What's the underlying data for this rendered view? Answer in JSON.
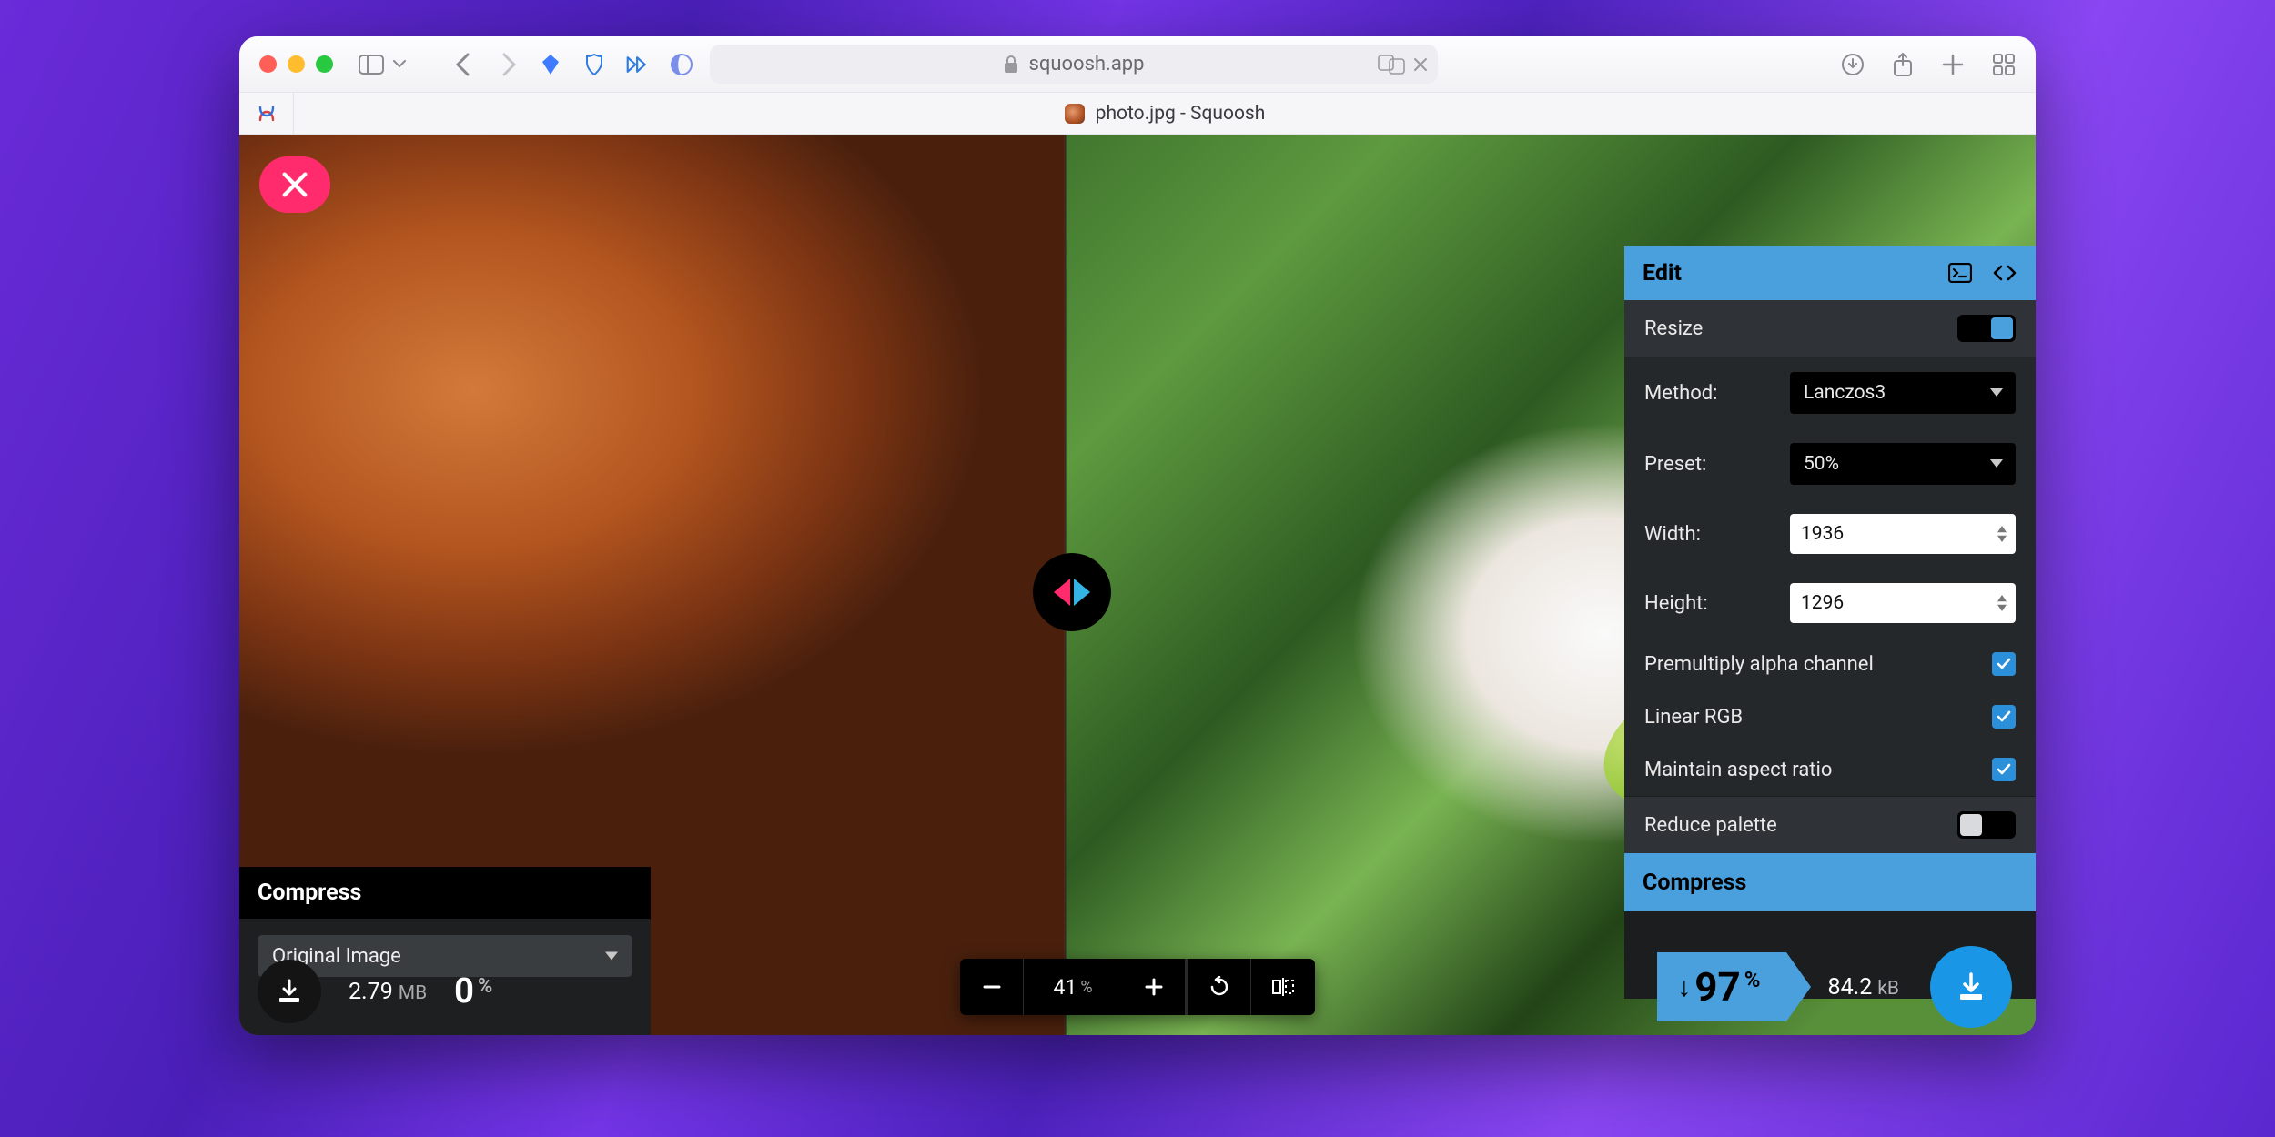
{
  "browser": {
    "url_display": "squoosh.app",
    "tab_title": "photo.jpg - Squoosh"
  },
  "zoom": {
    "value": "41",
    "unit": "%"
  },
  "left_panel": {
    "title": "Compress",
    "format_selected": "Original Image",
    "size_value": "2.79",
    "size_unit": "MB",
    "reduction_value": "0",
    "reduction_unit": "%"
  },
  "right_panel": {
    "title": "Edit",
    "resize": {
      "label": "Resize",
      "on": true
    },
    "method": {
      "label": "Method:",
      "value": "Lanczos3"
    },
    "preset": {
      "label": "Preset:",
      "value": "50%"
    },
    "width": {
      "label": "Width:",
      "value": "1936"
    },
    "height": {
      "label": "Height:",
      "value": "1296"
    },
    "premultiply": {
      "label": "Premultiply alpha channel",
      "checked": true
    },
    "linear_rgb": {
      "label": "Linear RGB",
      "checked": true
    },
    "aspect": {
      "label": "Maintain aspect ratio",
      "checked": true
    },
    "reduce_palette": {
      "label": "Reduce palette",
      "on": false
    },
    "compress_title": "Compress"
  },
  "result": {
    "reduction_value": "97",
    "reduction_unit": "%",
    "size_value": "84.2",
    "size_unit": "kB"
  }
}
